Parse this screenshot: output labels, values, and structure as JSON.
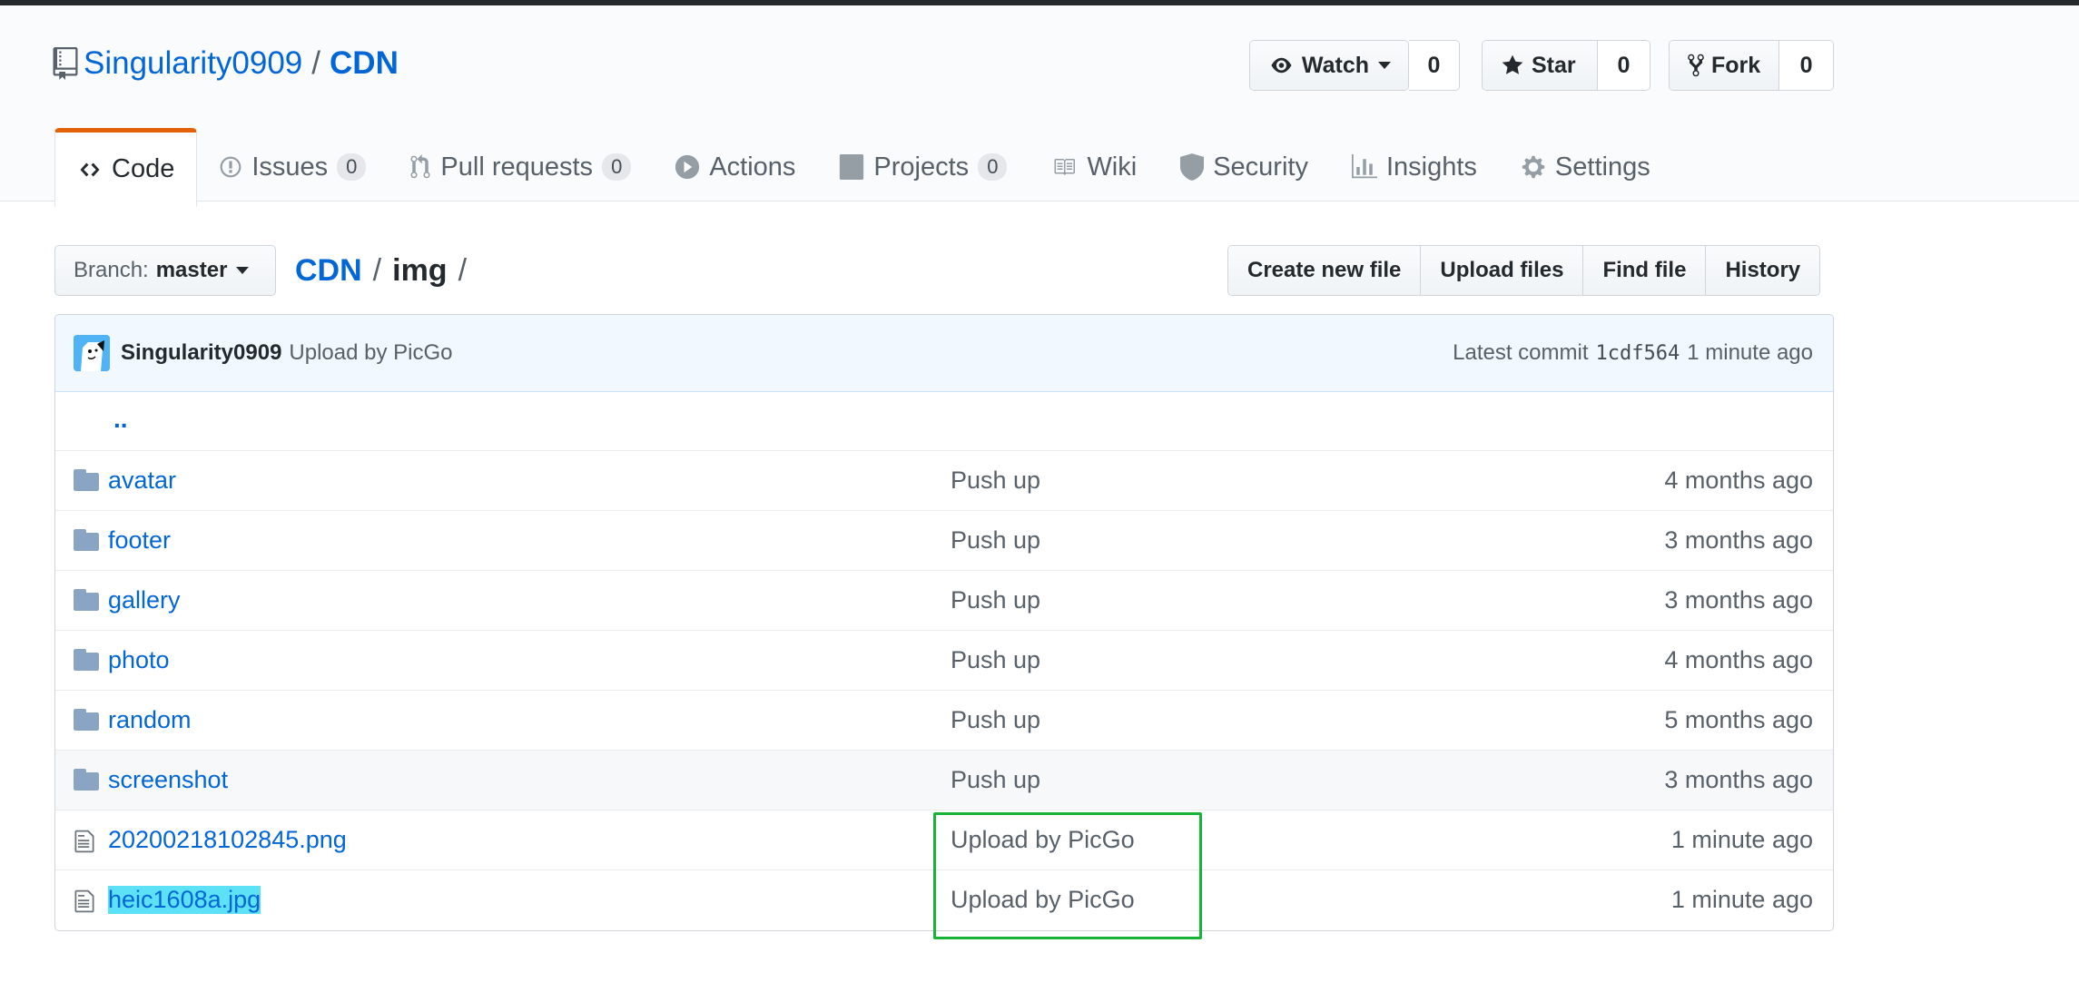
{
  "repo": {
    "owner": "Singularity0909",
    "name": "CDN",
    "separator": "/"
  },
  "social": {
    "watch_label": "Watch",
    "watch_count": "0",
    "star_label": "Star",
    "star_count": "0",
    "fork_label": "Fork",
    "fork_count": "0"
  },
  "tabs": [
    {
      "label": "Code",
      "icon": "code-icon"
    },
    {
      "label": "Issues",
      "count": "0",
      "icon": "issue-icon"
    },
    {
      "label": "Pull requests",
      "count": "0",
      "icon": "pull-request-icon"
    },
    {
      "label": "Actions",
      "icon": "play-icon"
    },
    {
      "label": "Projects",
      "count": "0",
      "icon": "project-icon"
    },
    {
      "label": "Wiki",
      "icon": "book-icon"
    },
    {
      "label": "Security",
      "icon": "shield-icon"
    },
    {
      "label": "Insights",
      "icon": "graph-icon"
    },
    {
      "label": "Settings",
      "icon": "gear-icon"
    }
  ],
  "branch": {
    "prefix": "Branch:",
    "name": "master"
  },
  "breadcrumb": {
    "root": "CDN",
    "path": "img",
    "sep": "/"
  },
  "file_actions": {
    "create": "Create new file",
    "upload": "Upload files",
    "find": "Find file",
    "history": "History"
  },
  "commit": {
    "author": "Singularity0909",
    "message": "Upload by PicGo",
    "latest_label": "Latest commit",
    "sha": "1cdf564",
    "age": "1 minute ago"
  },
  "parent_dir": "..",
  "files": [
    {
      "type": "dir",
      "name": "avatar",
      "message": "Push up",
      "age": "4 months ago"
    },
    {
      "type": "dir",
      "name": "footer",
      "message": "Push up",
      "age": "3 months ago"
    },
    {
      "type": "dir",
      "name": "gallery",
      "message": "Push up",
      "age": "3 months ago"
    },
    {
      "type": "dir",
      "name": "photo",
      "message": "Push up",
      "age": "4 months ago"
    },
    {
      "type": "dir",
      "name": "random",
      "message": "Push up",
      "age": "5 months ago"
    },
    {
      "type": "dir",
      "name": "screenshot",
      "message": "Push up",
      "age": "3 months ago"
    },
    {
      "type": "file",
      "name": "20200218102845.png",
      "message": "Upload by PicGo",
      "age": "1 minute ago"
    },
    {
      "type": "file",
      "name": "heic1608a.jpg",
      "message": "Upload by PicGo",
      "age": "1 minute ago"
    }
  ],
  "colors": {
    "link": "#0366d6",
    "tab_accent": "#e36209",
    "highlight_box": "#1ab33a",
    "selection": "#5ce1f7"
  }
}
